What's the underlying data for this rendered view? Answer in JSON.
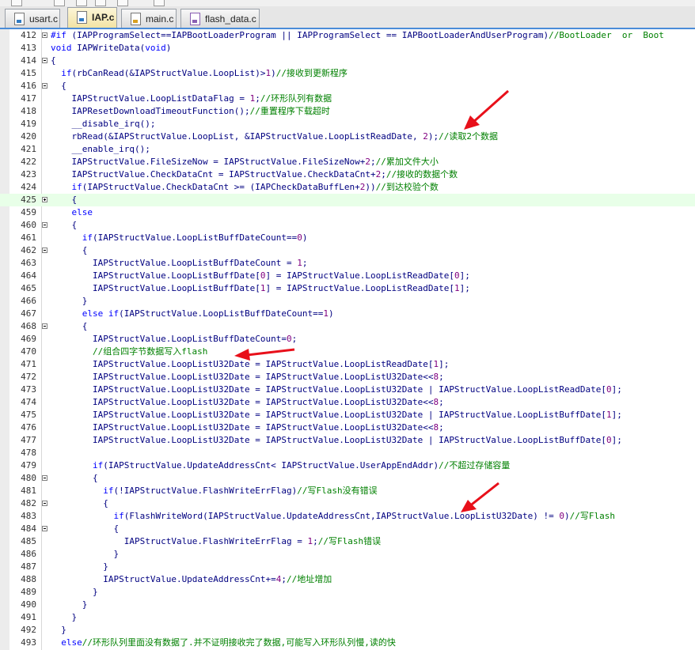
{
  "tabs": [
    {
      "label": "usart.c",
      "active": false,
      "icon": "c-file-icon"
    },
    {
      "label": "IAP.c",
      "active": true,
      "icon": "c-file-icon"
    },
    {
      "label": "main.c",
      "active": false,
      "icon": "c-file-icon"
    },
    {
      "label": "flash_data.c",
      "active": false,
      "icon": "c-file-icon"
    }
  ],
  "colors": {
    "keyword": "#0000ff",
    "comment": "#008000",
    "number": "#800080",
    "identifier": "#000080",
    "highlight": "#e8ffe8",
    "arrow": "#e8101a"
  },
  "lines": [
    {
      "n": "412",
      "fold": "minus",
      "code": "#if (IAPProgramSelect==IAPBootLoaderProgram || IAPProgramSelect == IAPBootLoaderAndUserProgram)//BootLoader  or  Boot"
    },
    {
      "n": "413",
      "fold": "",
      "code": "void IAPWriteData(void)"
    },
    {
      "n": "414",
      "fold": "minus",
      "code": "{"
    },
    {
      "n": "415",
      "fold": "",
      "code": "  if(rbCanRead(&IAPStructValue.LoopList)>1)//接收到更新程序"
    },
    {
      "n": "416",
      "fold": "minus",
      "code": "  {"
    },
    {
      "n": "417",
      "fold": "",
      "code": "    IAPStructValue.LoopListDataFlag = 1;//环形队列有数据"
    },
    {
      "n": "418",
      "fold": "",
      "code": "    IAPResetDownloadTimeoutFunction();//重置程序下载超时"
    },
    {
      "n": "419",
      "fold": "",
      "code": "    __disable_irq();"
    },
    {
      "n": "420",
      "fold": "",
      "code": "    rbRead(&IAPStructValue.LoopList, &IAPStructValue.LoopListReadDate, 2);//读取2个数据"
    },
    {
      "n": "421",
      "fold": "",
      "code": "    __enable_irq();"
    },
    {
      "n": "422",
      "fold": "",
      "code": "    IAPStructValue.FileSizeNow = IAPStructValue.FileSizeNow+2;//累加文件大小"
    },
    {
      "n": "423",
      "fold": "",
      "code": "    IAPStructValue.CheckDataCnt = IAPStructValue.CheckDataCnt+2;//接收的数据个数"
    },
    {
      "n": "424",
      "fold": "",
      "code": "    if(IAPStructValue.CheckDataCnt >= (IAPCheckDataBuffLen+2))//到达校验个数"
    },
    {
      "n": "425",
      "fold": "plus",
      "code": "    {"
    },
    {
      "n": "459",
      "fold": "",
      "code": "    else"
    },
    {
      "n": "460",
      "fold": "minus",
      "code": "    {"
    },
    {
      "n": "461",
      "fold": "",
      "code": "      if(IAPStructValue.LoopListBuffDateCount==0)"
    },
    {
      "n": "462",
      "fold": "minus",
      "code": "      {"
    },
    {
      "n": "463",
      "fold": "",
      "code": "        IAPStructValue.LoopListBuffDateCount = 1;"
    },
    {
      "n": "464",
      "fold": "",
      "code": "        IAPStructValue.LoopListBuffDate[0] = IAPStructValue.LoopListReadDate[0];"
    },
    {
      "n": "465",
      "fold": "",
      "code": "        IAPStructValue.LoopListBuffDate[1] = IAPStructValue.LoopListReadDate[1];"
    },
    {
      "n": "466",
      "fold": "",
      "code": "      }"
    },
    {
      "n": "467",
      "fold": "",
      "code": "      else if(IAPStructValue.LoopListBuffDateCount==1)"
    },
    {
      "n": "468",
      "fold": "minus",
      "code": "      {"
    },
    {
      "n": "469",
      "fold": "",
      "code": "        IAPStructValue.LoopListBuffDateCount=0;"
    },
    {
      "n": "470",
      "fold": "",
      "code": "        //组合四字节数据写入flash"
    },
    {
      "n": "471",
      "fold": "",
      "code": "        IAPStructValue.LoopListU32Date = IAPStructValue.LoopListReadDate[1];"
    },
    {
      "n": "472",
      "fold": "",
      "code": "        IAPStructValue.LoopListU32Date = IAPStructValue.LoopListU32Date<<8;"
    },
    {
      "n": "473",
      "fold": "",
      "code": "        IAPStructValue.LoopListU32Date = IAPStructValue.LoopListU32Date | IAPStructValue.LoopListReadDate[0];"
    },
    {
      "n": "474",
      "fold": "",
      "code": "        IAPStructValue.LoopListU32Date = IAPStructValue.LoopListU32Date<<8;"
    },
    {
      "n": "475",
      "fold": "",
      "code": "        IAPStructValue.LoopListU32Date = IAPStructValue.LoopListU32Date | IAPStructValue.LoopListBuffDate[1];"
    },
    {
      "n": "476",
      "fold": "",
      "code": "        IAPStructValue.LoopListU32Date = IAPStructValue.LoopListU32Date<<8;"
    },
    {
      "n": "477",
      "fold": "",
      "code": "        IAPStructValue.LoopListU32Date = IAPStructValue.LoopListU32Date | IAPStructValue.LoopListBuffDate[0];"
    },
    {
      "n": "478",
      "fold": "",
      "code": ""
    },
    {
      "n": "479",
      "fold": "",
      "code": "        if(IAPStructValue.UpdateAddressCnt< IAPStructValue.UserAppEndAddr)//不超过存储容量"
    },
    {
      "n": "480",
      "fold": "minus",
      "code": "        {"
    },
    {
      "n": "481",
      "fold": "",
      "code": "          if(!IAPStructValue.FlashWriteErrFlag)//写Flash没有错误"
    },
    {
      "n": "482",
      "fold": "minus",
      "code": "          {"
    },
    {
      "n": "483",
      "fold": "",
      "code": "            if(FlashWriteWord(IAPStructValue.UpdateAddressCnt,IAPStructValue.LoopListU32Date) != 0)//写Flash"
    },
    {
      "n": "484",
      "fold": "minus",
      "code": "            {"
    },
    {
      "n": "485",
      "fold": "",
      "code": "              IAPStructValue.FlashWriteErrFlag = 1;//写Flash错误"
    },
    {
      "n": "486",
      "fold": "",
      "code": "            }"
    },
    {
      "n": "487",
      "fold": "",
      "code": "          }"
    },
    {
      "n": "488",
      "fold": "",
      "code": "          IAPStructValue.UpdateAddressCnt+=4;//地址增加"
    },
    {
      "n": "489",
      "fold": "",
      "code": "        }"
    },
    {
      "n": "490",
      "fold": "",
      "code": "      }"
    },
    {
      "n": "491",
      "fold": "",
      "code": "    }"
    },
    {
      "n": "492",
      "fold": "",
      "code": "  }"
    },
    {
      "n": "493",
      "fold": "",
      "code": "  else//环形队列里面没有数据了.并不证明接收完了数据,可能写入环形队列慢,读的快"
    }
  ]
}
